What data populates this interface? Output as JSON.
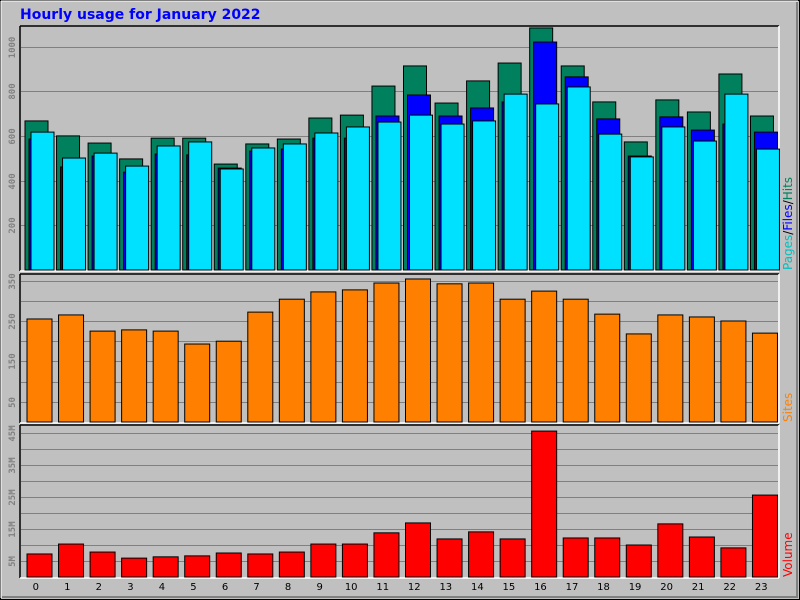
{
  "chart_data": {
    "title": "Hourly usage for January 2022",
    "colors": {
      "background": "#c0c0c0",
      "title": "#0000ff",
      "grid": "#808080",
      "hits": "#00805c",
      "files": "#0000ff",
      "pages": "#00e0ff",
      "sites": "#ff8000",
      "volume": "#ff0000",
      "tick": "#808080"
    },
    "categories": [
      "0",
      "1",
      "2",
      "3",
      "4",
      "5",
      "6",
      "7",
      "8",
      "9",
      "10",
      "11",
      "12",
      "13",
      "14",
      "15",
      "16",
      "17",
      "18",
      "19",
      "20",
      "21",
      "22",
      "23"
    ],
    "panels": [
      {
        "id": "pages-files-hits",
        "type": "bar",
        "side_label_parts": [
          {
            "text": "Pages",
            "color": "#00c0c0"
          },
          {
            "text": "/",
            "color": "#000000"
          },
          {
            "text": "Files",
            "color": "#0000ff"
          },
          {
            "text": "/",
            "color": "#000000"
          },
          {
            "text": "Hits",
            "color": "#00805c"
          }
        ],
        "ylim": [
          0,
          1080
        ],
        "yticks": [
          200,
          400,
          600,
          800,
          1000
        ],
        "ytick_labels": [
          "200",
          "400",
          "600",
          "800",
          "1000"
        ],
        "series": [
          {
            "name": "Hits",
            "color": "#00805c",
            "values": [
              667,
              600,
              568,
              497,
              590,
              590,
              474,
              564,
              586,
              680,
              693,
              823,
              913,
              747,
              846,
              926,
              1083,
              913,
              752,
              573,
              761,
              707,
              877,
              689
            ]
          },
          {
            "name": "Files",
            "color": "#0000ff",
            "values": [
              586,
              461,
              510,
              438,
              519,
              515,
              456,
              532,
              541,
              590,
              590,
              689,
              783,
              689,
              725,
              752,
              1020,
              864,
              676,
              510,
              685,
              626,
              653,
              617
            ]
          },
          {
            "name": "Pages",
            "color": "#00e0ff",
            "values": [
              617,
              501,
              523,
              465,
              555,
              573,
              452,
              546,
              564,
              613,
              640,
              662,
              693,
              653,
              667,
              787,
              743,
              819,
              608,
              506,
              640,
              577,
              787,
              541
            ]
          }
        ]
      },
      {
        "id": "sites",
        "type": "bar",
        "side_label_parts": [
          {
            "text": "Sites",
            "color": "#ff8000"
          }
        ],
        "ylim": [
          0,
          350
        ],
        "yticks": [
          50,
          100,
          150,
          200,
          250,
          300,
          350
        ],
        "ytick_labels": [
          "50",
          "",
          "150",
          "",
          "250",
          "",
          "350"
        ],
        "series": [
          {
            "name": "Sites",
            "color": "#ff8000",
            "values": [
              255,
              265,
              225,
              228,
              225,
              193,
              200,
              272,
              304,
              322,
              327,
              344,
              354,
              342,
              344,
              304,
              324,
              304,
              267,
              218,
              265,
              260,
              250,
              220
            ]
          }
        ]
      },
      {
        "id": "volume",
        "type": "bar",
        "side_label_parts": [
          {
            "text": "Volume",
            "color": "#ff0000"
          }
        ],
        "unit": "M",
        "ylim": [
          0,
          45
        ],
        "yticks": [
          5,
          10,
          15,
          20,
          25,
          30,
          35,
          40,
          45
        ],
        "ytick_labels": [
          "5M",
          "",
          "15M",
          "",
          "25M",
          "",
          "35M",
          "",
          "45M"
        ],
        "series": [
          {
            "name": "Volume (MB)",
            "color": "#ff0000",
            "values": [
              7.2,
              10.3,
              7.8,
              5.9,
              6.3,
              6.6,
              7.5,
              7.2,
              7.8,
              10.3,
              10.3,
              13.8,
              16.9,
              11.9,
              14.1,
              11.9,
              45.6,
              12.2,
              12.2,
              10.0,
              16.6,
              12.5,
              9.1,
              25.6
            ]
          }
        ]
      }
    ],
    "xlabel": "",
    "grid": true,
    "legend": "right-vertical"
  }
}
